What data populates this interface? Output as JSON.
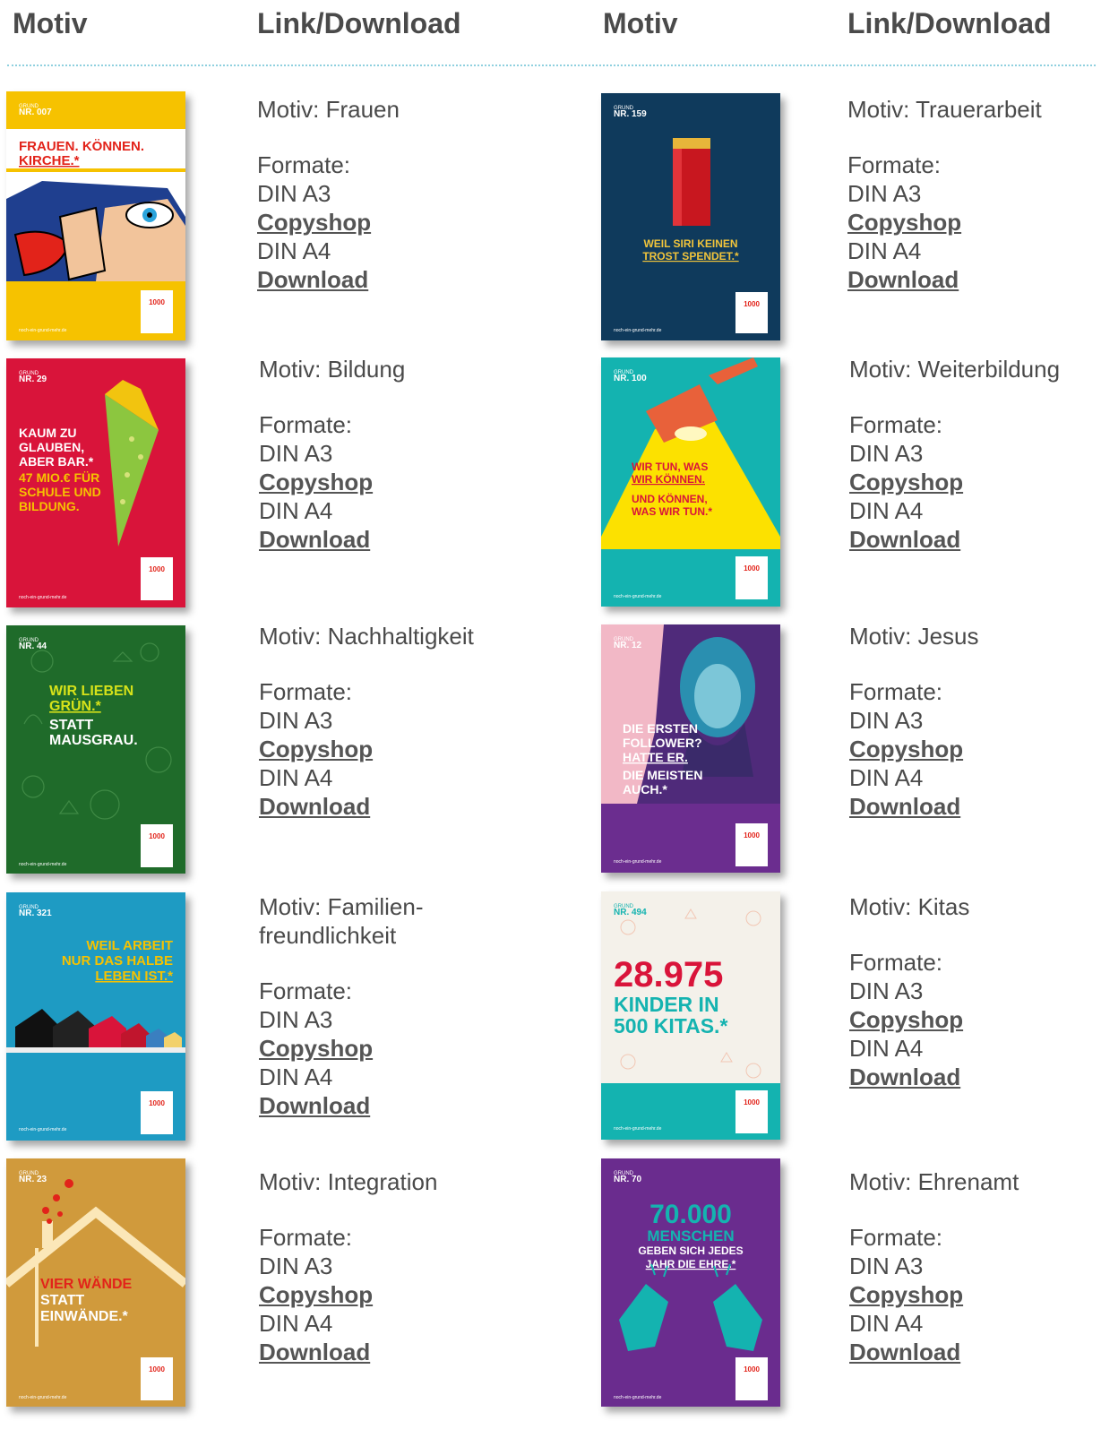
{
  "header": {
    "col1": "Motiv",
    "col2": "Link/Download",
    "col3": "Motiv",
    "col4": "Link/Download"
  },
  "labels": {
    "formate": "Formate:",
    "a3": "DIN A3",
    "copyshop": "Copyshop",
    "a4": "DIN A4",
    "download": "Download"
  },
  "items": [
    {
      "motiv": "Motiv: Frauen",
      "grund": "GRUND",
      "nr": "NR. 007",
      "headline": "FRAUEN. KÖNNEN. KIRCHE.*",
      "bg": "#f6c200",
      "footer": "noch-ein-grund-mehr.de"
    },
    {
      "motiv": "Motiv: Trauerarbeit",
      "grund": "GRUND",
      "nr": "NR. 159",
      "headline": "WEIL SIRI KEINEN TROST SPENDET.*",
      "bg": "#0f3a5c",
      "footer": "noch-ein-grund-mehr.de"
    },
    {
      "motiv": "Motiv: Bildung",
      "grund": "GRUND",
      "nr": "NR. 29",
      "headline": "KAUM ZU GLAUBEN, ABER BAR.* 47 MIO.€ FÜR SCHULE UND BILDUNG.",
      "bg": "#d9143a",
      "footer": "noch-ein-grund-mehr.de"
    },
    {
      "motiv": "Motiv: Weiterbildung",
      "grund": "GRUND",
      "nr": "NR. 100",
      "headline": "WIR TUN, WAS WIR KÖNNEN. UND KÖNNEN, WAS WIR TUN.*",
      "bg": "#14b3b0",
      "footer": "noch-ein-grund-mehr.de"
    },
    {
      "motiv": "Motiv: Nachhaltigkeit",
      "grund": "GRUND",
      "nr": "NR. 44",
      "headline": "WIR LIEBEN GRÜN.* STATT MAUSGRAU.",
      "bg": "#1f6b2a",
      "footer": "noch-ein-grund-mehr.de"
    },
    {
      "motiv": "Motiv: Jesus",
      "grund": "GRUND",
      "nr": "NR. 12",
      "headline": "DIE ERSTEN FOLLOWER? HATTE ER. DIE MEISTEN AUCH.*",
      "bg": "#6b2d8f",
      "footer": "noch-ein-grund-mehr.de"
    },
    {
      "motiv": "Motiv: Familien-freundlichkeit",
      "grund": "GRUND",
      "nr": "NR. 321",
      "headline": "WEIL ARBEIT NUR DAS HALBE LEBEN IST.*",
      "bg": "#1e9bc3",
      "footer": "noch-ein-grund-mehr.de"
    },
    {
      "motiv": "Motiv: Kitas",
      "grund": "GRUND",
      "nr": "NR. 494",
      "headline": "28.975 KINDER IN 500 KITAS.*",
      "bg": "#f4f1ea",
      "footer": "noch-ein-grund-mehr.de"
    },
    {
      "motiv": "Motiv: Integration",
      "grund": "GRUND",
      "nr": "NR. 23",
      "headline": "VIER WÄNDE STATT EINWÄNDE.*",
      "bg": "#d09a3c",
      "footer": "noch-ein-grund-mehr.de"
    },
    {
      "motiv": "Motiv: Ehrenamt",
      "grund": "GRUND",
      "nr": "NR. 70",
      "headline": "70.000 MENSCHEN GEBEN SICH JEDES JAHR DIE EHRE.*",
      "bg": "#6a2c8e",
      "footer": "noch-ein-grund-mehr.de"
    }
  ]
}
